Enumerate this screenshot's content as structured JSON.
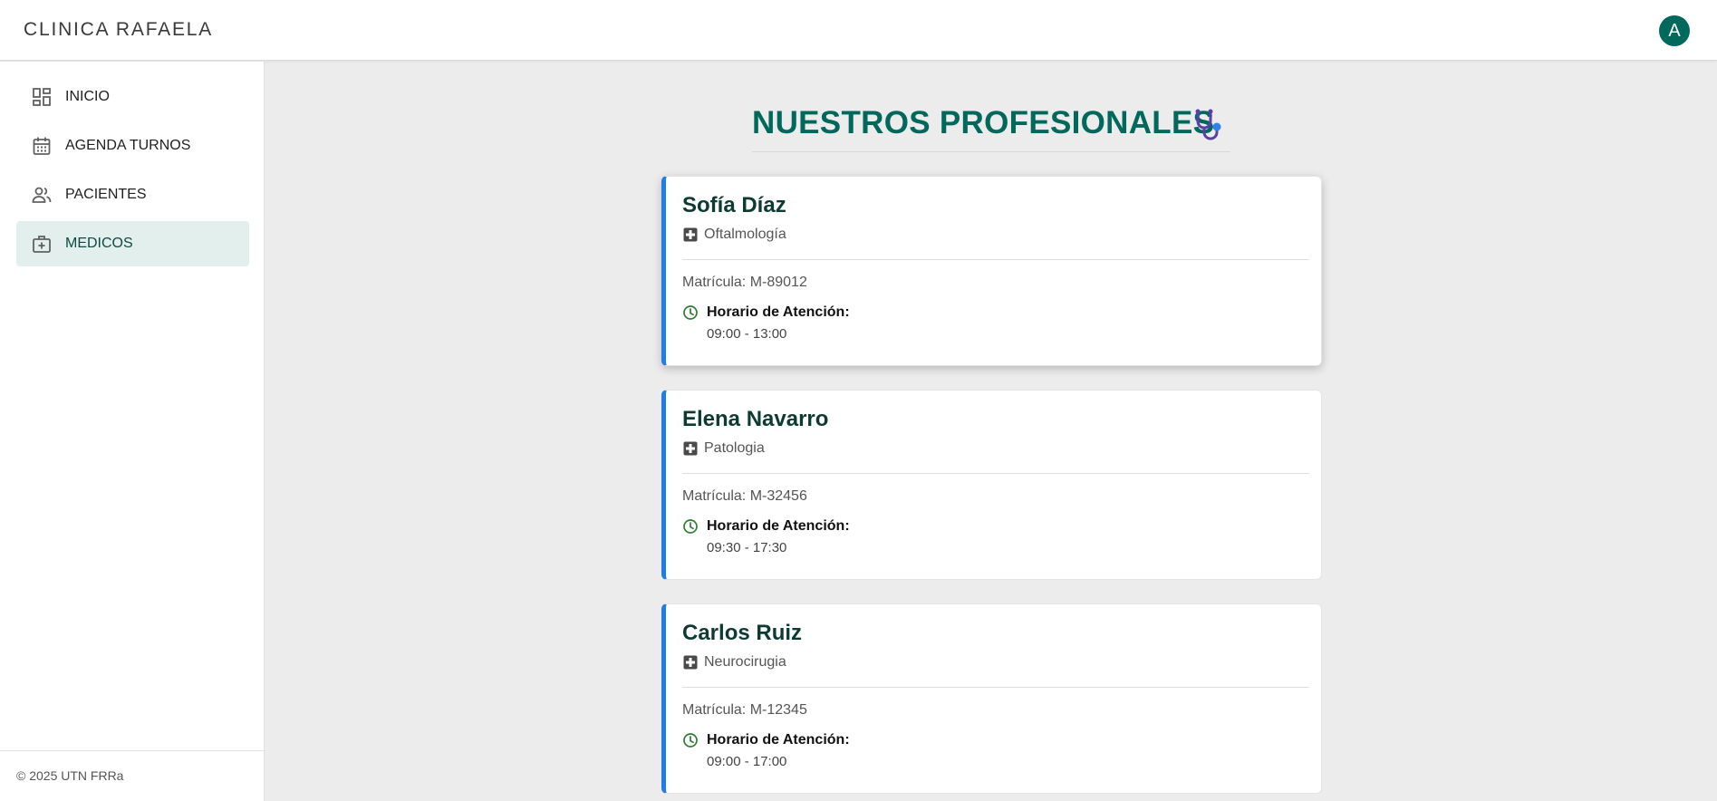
{
  "app": {
    "brand": "CLINICA RAFAELA",
    "avatar_initial": "A"
  },
  "sidebar": {
    "items": [
      {
        "label": "INICIO",
        "icon": "dashboard-icon",
        "active": false
      },
      {
        "label": "AGENDA TURNOS",
        "icon": "calendar-icon",
        "active": false
      },
      {
        "label": "PACIENTES",
        "icon": "people-icon",
        "active": false
      },
      {
        "label": "MEDICOS",
        "icon": "medical-bag-icon",
        "active": true
      }
    ],
    "footer": "© 2025 UTN FRRa"
  },
  "main": {
    "title": "NUESTROS PROFESIONALES",
    "title_icon": "stethoscope-icon",
    "doctors": [
      {
        "name": "Sofía Díaz",
        "specialty": "Oftalmología",
        "matricula": "Matrícula: M-89012",
        "horario_label": "Horario de Atención:",
        "horario": "09:00 - 13:00"
      },
      {
        "name": "Elena Navarro",
        "specialty": "Patologia",
        "matricula": "Matrícula: M-32456",
        "horario_label": "Horario de Atención:",
        "horario": "09:30 - 17:30"
      },
      {
        "name": "Carlos Ruiz",
        "specialty": "Neurocirugia",
        "matricula": "Matrícula: M-12345",
        "horario_label": "Horario de Atención:",
        "horario": "09:00 - 17:00"
      }
    ]
  },
  "colors": {
    "primary": "#00695c",
    "card_accent": "#1e7ee8",
    "active_nav_bg": "#e3efec",
    "clock_green": "#2e7d32",
    "background": "#ececec"
  }
}
